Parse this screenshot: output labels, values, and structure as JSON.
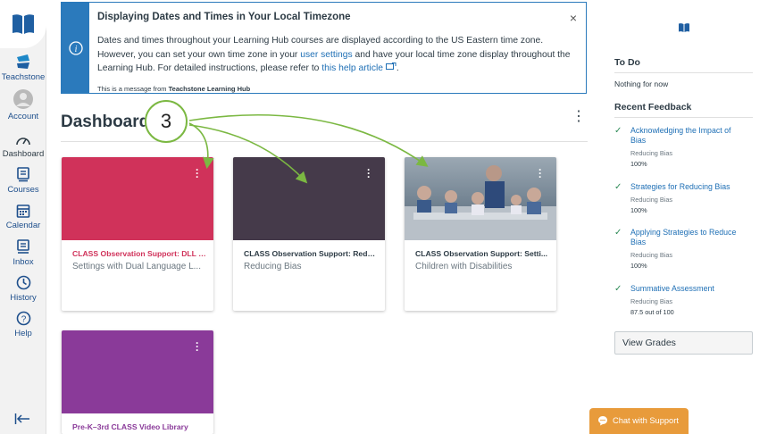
{
  "nav": {
    "items": [
      {
        "label": "Teachstone"
      },
      {
        "label": "Account"
      },
      {
        "label": "Dashboard"
      },
      {
        "label": "Courses"
      },
      {
        "label": "Calendar"
      },
      {
        "label": "Inbox"
      },
      {
        "label": "History"
      },
      {
        "label": "Help"
      }
    ]
  },
  "alert": {
    "title": "Displaying Dates and Times in Your Local Timezone",
    "close": "×",
    "body_1": "Dates and times throughout your Learning Hub courses are displayed according to the US Eastern time zone. However, you can set your own time zone in your",
    "link_settings": "user settings",
    "body_2": "and have your local time zone display throughout the Learning Hub. For detailed instructions, please refer to",
    "link_help": "this help article",
    "body_3": ".",
    "from_prefix": "This is a message from",
    "from_name": "Teachstone Learning Hub"
  },
  "dashboard": {
    "title": "Dashboard",
    "menu": "⋮",
    "annotation": "3",
    "cards": [
      {
        "title": "CLASS Observation Support: DLL (...",
        "subtitle": "Settings with Dual Language L...",
        "color": "#d0325a"
      },
      {
        "title": "CLASS Observation Support: Redu...",
        "subtitle": "Reducing Bias",
        "color": "#453a4a"
      },
      {
        "title": "CLASS Observation Support: Setti...",
        "subtitle": "Children with Disabilities",
        "color": "#7c8894"
      },
      {
        "title": "Pre-K–3rd CLASS Video Library",
        "subtitle": "",
        "color": "#8a3a99"
      }
    ]
  },
  "sidebar": {
    "todo_title": "To Do",
    "todo_empty": "Nothing for now",
    "feedback_title": "Recent Feedback",
    "feedback": [
      {
        "title": "Acknowledging the Impact of Bias",
        "course": "Reducing Bias",
        "score": "100%"
      },
      {
        "title": "Strategies for Reducing Bias",
        "course": "Reducing Bias",
        "score": "100%"
      },
      {
        "title": "Applying Strategies to Reduce Bias",
        "course": "Reducing Bias",
        "score": "100%"
      },
      {
        "title": "Summative Assessment",
        "course": "Reducing Bias",
        "score": "87.5 out of 100"
      }
    ],
    "grades_button": "View Grades"
  },
  "chat": {
    "label": "Chat with Support"
  }
}
